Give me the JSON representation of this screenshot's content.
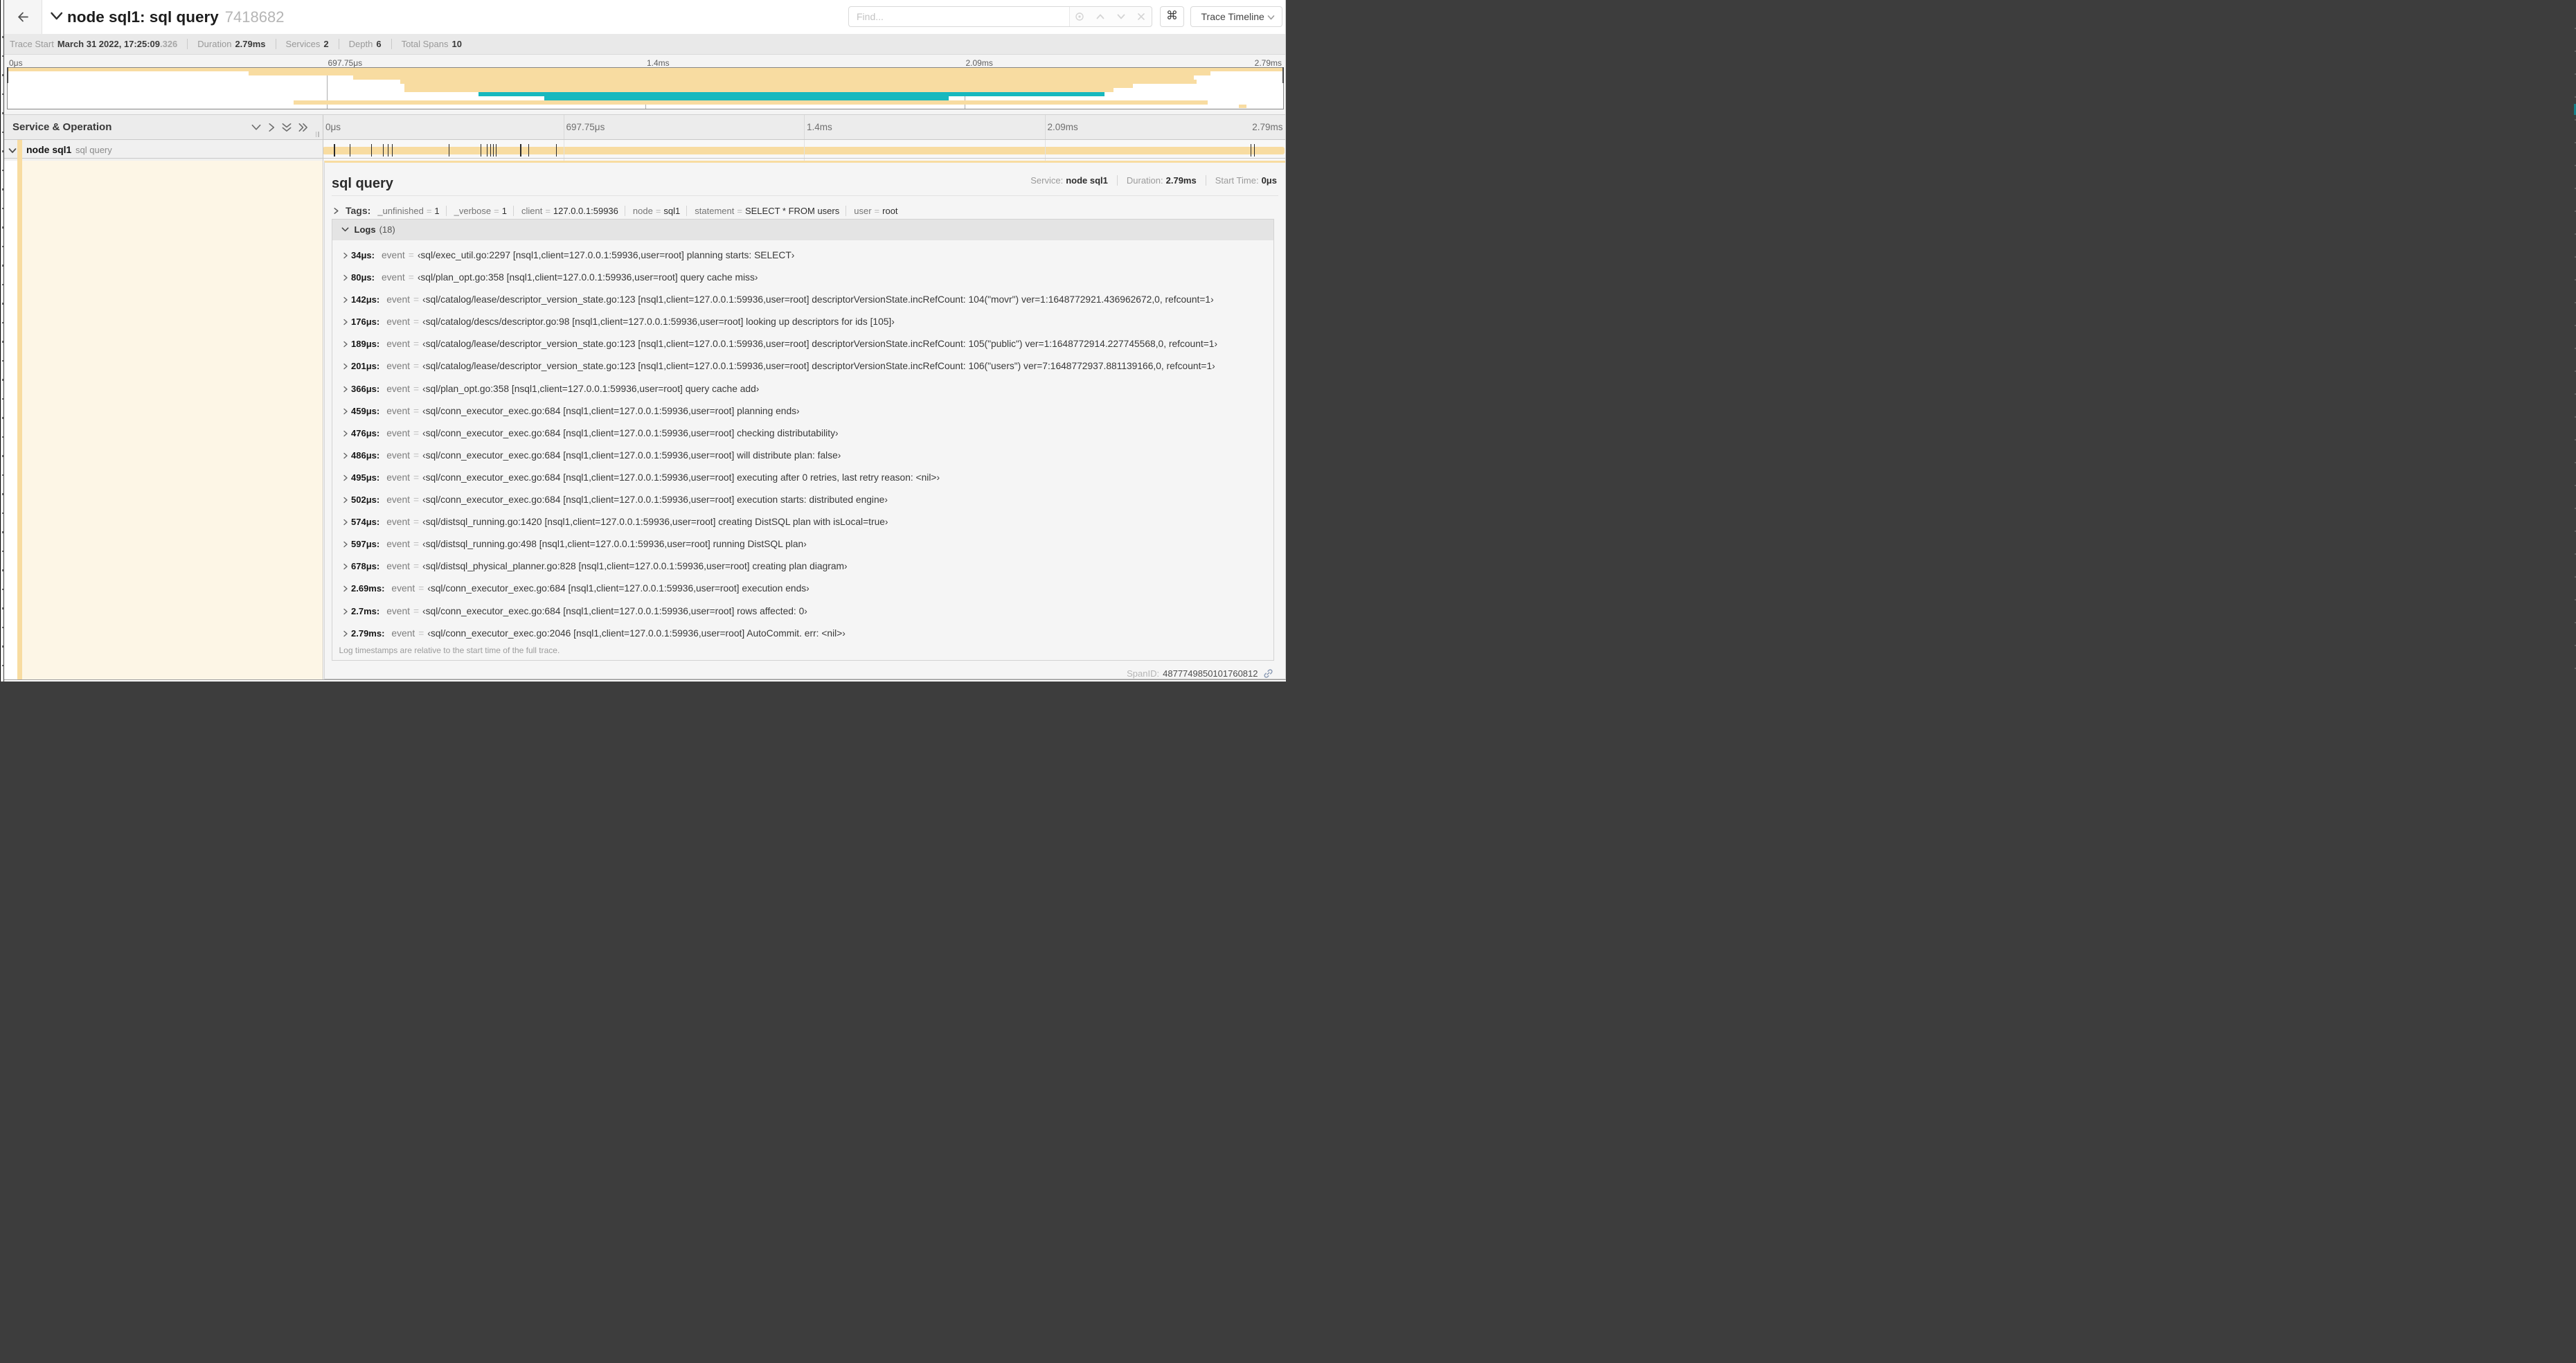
{
  "colors": {
    "tan": "#F8DCA1",
    "teal": "#17B8BE"
  },
  "header": {
    "title": "node sql1: sql query",
    "trace_id": "7418682",
    "find_placeholder": "Find...",
    "shortcut_icon": "⌘",
    "view_select_label": "Trace Timeline"
  },
  "summary": {
    "items": [
      {
        "label": "Trace Start",
        "value": "March 31 2022, 17:25:09",
        "suffix": ".326"
      },
      {
        "label": "Duration",
        "value": "2.79ms"
      },
      {
        "label": "Services",
        "value": "2"
      },
      {
        "label": "Depth",
        "value": "6"
      },
      {
        "label": "Total Spans",
        "value": "10"
      }
    ]
  },
  "minimap": {
    "tick_labels": [
      "0μs",
      "697.75μs",
      "1.4ms",
      "2.09ms",
      "2.79ms"
    ],
    "lanes": [
      {
        "color": "tan",
        "start": 0.0,
        "end": 1.0
      },
      {
        "color": "tan",
        "start": 0.189,
        "end": 0.943
      },
      {
        "color": "tan",
        "start": 0.271,
        "end": 0.93
      },
      {
        "color": "tan",
        "start": 0.308,
        "end": 0.932
      },
      {
        "color": "tan",
        "start": 0.311,
        "end": 0.882
      },
      {
        "color": "tan",
        "start": 0.311,
        "end": 0.867
      },
      {
        "color": "teal",
        "start": 0.369,
        "end": 0.86
      },
      {
        "color": "teal",
        "start": 0.421,
        "end": 0.738
      },
      {
        "color": "tan",
        "start": 0.224,
        "end": 0.941
      },
      {
        "color": "tan",
        "start": 0.965,
        "end": 0.971
      }
    ]
  },
  "timeline": {
    "column_header": "Service & Operation",
    "tick_labels": [
      "0μs",
      "697.75μs",
      "1.4ms",
      "2.09ms",
      "2.79ms"
    ],
    "duration_us": 2790,
    "span_row": {
      "service": "node sql1",
      "operation": "sql query",
      "log_marker_times_us": [
        34,
        80,
        142,
        176,
        189,
        201,
        366,
        459,
        476,
        486,
        495,
        502,
        574,
        597,
        678,
        2690,
        2700,
        2790
      ]
    }
  },
  "detail": {
    "operation": "sql query",
    "info": [
      {
        "label": "Service:",
        "value": "node sql1"
      },
      {
        "label": "Duration:",
        "value": "2.79ms"
      },
      {
        "label": "Start Time:",
        "value": "0μs"
      }
    ],
    "tags_label": "Tags:",
    "tags": [
      {
        "key": "_unfinished",
        "value": "1"
      },
      {
        "key": "_verbose",
        "value": "1"
      },
      {
        "key": "client",
        "value": "127.0.0.1:59936"
      },
      {
        "key": "node",
        "value": "sql1"
      },
      {
        "key": "statement",
        "value": "SELECT * FROM users"
      },
      {
        "key": "user",
        "value": "root"
      }
    ],
    "logs_label": "Logs",
    "logs_count": "(18)",
    "log_key": "event",
    "logs": [
      {
        "time": "34μs:",
        "value": "‹sql/exec_util.go:2297 [nsql1,client=127.0.0.1:59936,user=root] planning starts: SELECT›"
      },
      {
        "time": "80μs:",
        "value": "‹sql/plan_opt.go:358 [nsql1,client=127.0.0.1:59936,user=root] query cache miss›"
      },
      {
        "time": "142μs:",
        "value": "‹sql/catalog/lease/descriptor_version_state.go:123 [nsql1,client=127.0.0.1:59936,user=root] descriptorVersionState.incRefCount: 104(\"movr\") ver=1:1648772921.436962672,0, refcount=1›"
      },
      {
        "time": "176μs:",
        "value": "‹sql/catalog/descs/descriptor.go:98 [nsql1,client=127.0.0.1:59936,user=root] looking up descriptors for ids [105]›"
      },
      {
        "time": "189μs:",
        "value": "‹sql/catalog/lease/descriptor_version_state.go:123 [nsql1,client=127.0.0.1:59936,user=root] descriptorVersionState.incRefCount: 105(\"public\") ver=1:1648772914.227745568,0, refcount=1›"
      },
      {
        "time": "201μs:",
        "value": "‹sql/catalog/lease/descriptor_version_state.go:123 [nsql1,client=127.0.0.1:59936,user=root] descriptorVersionState.incRefCount: 106(\"users\") ver=7:1648772937.881139166,0, refcount=1›"
      },
      {
        "time": "366μs:",
        "value": "‹sql/plan_opt.go:358 [nsql1,client=127.0.0.1:59936,user=root] query cache add›"
      },
      {
        "time": "459μs:",
        "value": "‹sql/conn_executor_exec.go:684 [nsql1,client=127.0.0.1:59936,user=root] planning ends›"
      },
      {
        "time": "476μs:",
        "value": "‹sql/conn_executor_exec.go:684 [nsql1,client=127.0.0.1:59936,user=root] checking distributability›"
      },
      {
        "time": "486μs:",
        "value": "‹sql/conn_executor_exec.go:684 [nsql1,client=127.0.0.1:59936,user=root] will distribute plan: false›"
      },
      {
        "time": "495μs:",
        "value": "‹sql/conn_executor_exec.go:684 [nsql1,client=127.0.0.1:59936,user=root] executing after 0 retries, last retry reason: <nil>›"
      },
      {
        "time": "502μs:",
        "value": "‹sql/conn_executor_exec.go:684 [nsql1,client=127.0.0.1:59936,user=root] execution starts: distributed engine›"
      },
      {
        "time": "574μs:",
        "value": "‹sql/distsql_running.go:1420 [nsql1,client=127.0.0.1:59936,user=root] creating DistSQL plan with isLocal=true›"
      },
      {
        "time": "597μs:",
        "value": "‹sql/distsql_running.go:498 [nsql1,client=127.0.0.1:59936,user=root] running DistSQL plan›"
      },
      {
        "time": "678μs:",
        "value": "‹sql/distsql_physical_planner.go:828 [nsql1,client=127.0.0.1:59936,user=root] creating plan diagram›"
      },
      {
        "time": "2.69ms:",
        "value": "‹sql/conn_executor_exec.go:684 [nsql1,client=127.0.0.1:59936,user=root] execution ends›"
      },
      {
        "time": "2.7ms:",
        "value": "‹sql/conn_executor_exec.go:684 [nsql1,client=127.0.0.1:59936,user=root] rows affected: 0›"
      },
      {
        "time": "2.79ms:",
        "value": "‹sql/conn_executor_exec.go:2046 [nsql1,client=127.0.0.1:59936,user=root] AutoCommit. err: <nil>›"
      }
    ],
    "logs_note": "Log timestamps are relative to the start time of the full trace.",
    "span_id_label": "SpanID:",
    "span_id": "4877749850101760812"
  }
}
